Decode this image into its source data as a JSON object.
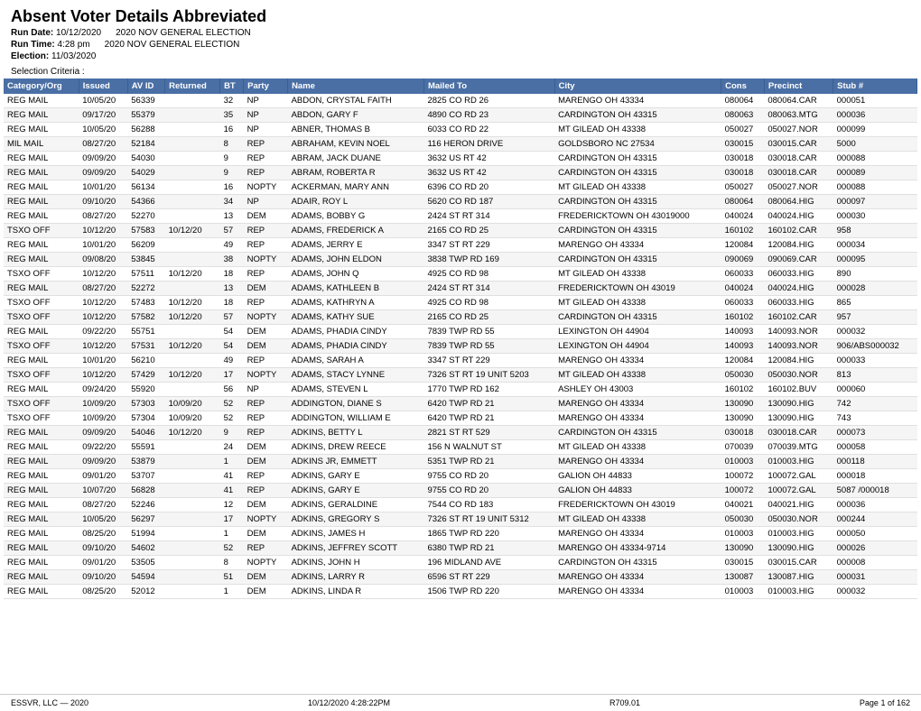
{
  "header": {
    "title": "Absent Voter Details Abbreviated",
    "run_date_label": "Run Date:",
    "run_date_value": "10/12/2020",
    "run_date_election": "2020 NOV GENERAL ELECTION",
    "run_time_label": "Run Time:",
    "run_time_value": "4:28 pm",
    "run_time_election": "2020 NOV GENERAL ELECTION",
    "election_label": "Election:",
    "election_value": "11/03/2020",
    "selection_label": "Selection Criteria :"
  },
  "columns": [
    "Category/Org",
    "Issued",
    "AV ID",
    "Returned",
    "BT",
    "Party",
    "Name",
    "Mailed To",
    "City",
    "Cons",
    "Precinct",
    "Stub #"
  ],
  "rows": [
    [
      "REG",
      "MAIL",
      "10/05/20",
      "56339",
      "",
      "32",
      "NP",
      "ABDON, CRYSTAL FAITH",
      "2825 CO RD 26",
      "MARENGO OH 43334",
      "080064",
      "080064.CAR",
      "000051"
    ],
    [
      "REG",
      "MAIL",
      "09/17/20",
      "55379",
      "",
      "35",
      "NP",
      "ABDON, GARY F",
      "4890 CO RD 23",
      "CARDINGTON OH 43315",
      "080063",
      "080063.MTG",
      "000036"
    ],
    [
      "REG",
      "MAIL",
      "10/05/20",
      "56288",
      "",
      "16",
      "NP",
      "ABNER, THOMAS B",
      "6033 CO RD 22",
      "MT GILEAD OH 43338",
      "050027",
      "050027.NOR",
      "000099"
    ],
    [
      "MIL",
      "MAIL",
      "08/27/20",
      "52184",
      "",
      "8",
      "REP",
      "ABRAHAM, KEVIN NOEL",
      "116 HERON DRIVE",
      "GOLDSBORO NC 27534",
      "030015",
      "030015.CAR",
      "5000"
    ],
    [
      "REG",
      "MAIL",
      "09/09/20",
      "54030",
      "",
      "9",
      "REP",
      "ABRAM, JACK DUANE",
      "3632 US RT 42",
      "CARDINGTON OH 43315",
      "030018",
      "030018.CAR",
      "000088"
    ],
    [
      "REG",
      "MAIL",
      "09/09/20",
      "54029",
      "",
      "9",
      "REP",
      "ABRAM, ROBERTA R",
      "3632 US RT 42",
      "CARDINGTON OH 43315",
      "030018",
      "030018.CAR",
      "000089"
    ],
    [
      "REG",
      "MAIL",
      "10/01/20",
      "56134",
      "",
      "16",
      "NOPTY",
      "ACKERMAN, MARY ANN",
      "6396 CO RD 20",
      "MT GILEAD OH 43338",
      "050027",
      "050027.NOR",
      "000088"
    ],
    [
      "REG",
      "MAIL",
      "09/10/20",
      "54366",
      "",
      "34",
      "NP",
      "ADAIR, ROY L",
      "5620 CO RD 187",
      "CARDINGTON OH 43315",
      "080064",
      "080064.HIG",
      "000097"
    ],
    [
      "REG",
      "MAIL",
      "08/27/20",
      "52270",
      "",
      "13",
      "DEM",
      "ADAMS, BOBBY G",
      "2424 ST RT 314",
      "FREDERICKTOWN OH 43019000",
      "040024",
      "040024.HIG",
      "000030"
    ],
    [
      "TSXO",
      "OFF",
      "10/12/20",
      "57583",
      "10/12/20",
      "57",
      "REP",
      "ADAMS, FREDERICK A",
      "2165 CO RD 25",
      "CARDINGTON OH 43315",
      "160102",
      "160102.CAR",
      "958"
    ],
    [
      "REG",
      "MAIL",
      "10/01/20",
      "56209",
      "",
      "49",
      "REP",
      "ADAMS, JERRY E",
      "3347 ST RT 229",
      "MARENGO OH 43334",
      "120084",
      "120084.HIG",
      "000034"
    ],
    [
      "REG",
      "MAIL",
      "09/08/20",
      "53845",
      "",
      "38",
      "NOPTY",
      "ADAMS, JOHN ELDON",
      "3838 TWP RD 169",
      "CARDINGTON OH 43315",
      "090069",
      "090069.CAR",
      "000095"
    ],
    [
      "TSXO",
      "OFF",
      "10/12/20",
      "57511",
      "10/12/20",
      "18",
      "REP",
      "ADAMS, JOHN Q",
      "4925 CO RD 98",
      "MT GILEAD OH 43338",
      "060033",
      "060033.HIG",
      "890"
    ],
    [
      "REG",
      "MAIL",
      "08/27/20",
      "52272",
      "",
      "13",
      "DEM",
      "ADAMS, KATHLEEN B",
      "2424 ST RT 314",
      "FREDERICKTOWN OH 43019",
      "040024",
      "040024.HIG",
      "000028"
    ],
    [
      "TSXO",
      "OFF",
      "10/12/20",
      "57483",
      "10/12/20",
      "18",
      "REP",
      "ADAMS, KATHRYN A",
      "4925 CO RD 98",
      "MT GILEAD OH 43338",
      "060033",
      "060033.HIG",
      "865"
    ],
    [
      "TSXO",
      "OFF",
      "10/12/20",
      "57582",
      "10/12/20",
      "57",
      "NOPTY",
      "ADAMS, KATHY SUE",
      "2165 CO RD 25",
      "CARDINGTON OH 43315",
      "160102",
      "160102.CAR",
      "957"
    ],
    [
      "REG",
      "MAIL",
      "09/22/20",
      "55751",
      "",
      "54",
      "DEM",
      "ADAMS, PHADIA CINDY",
      "7839 TWP RD 55",
      "LEXINGTON OH 44904",
      "140093",
      "140093.NOR",
      "000032"
    ],
    [
      "TSXO",
      "OFF",
      "10/12/20",
      "57531",
      "10/12/20",
      "54",
      "DEM",
      "ADAMS, PHADIA CINDY",
      "7839 TWP RD 55",
      "LEXINGTON OH 44904",
      "140093",
      "140093.NOR",
      "906/ABS000032"
    ],
    [
      "REG",
      "MAIL",
      "10/01/20",
      "56210",
      "",
      "49",
      "REP",
      "ADAMS, SARAH A",
      "3347 ST RT 229",
      "MARENGO OH 43334",
      "120084",
      "120084.HIG",
      "000033"
    ],
    [
      "TSXO",
      "OFF",
      "10/12/20",
      "57429",
      "10/12/20",
      "17",
      "NOPTY",
      "ADAMS, STACY LYNNE",
      "7326 ST RT 19 UNIT 5203",
      "MT GILEAD OH 43338",
      "050030",
      "050030.NOR",
      "813"
    ],
    [
      "REG",
      "MAIL",
      "09/24/20",
      "55920",
      "",
      "56",
      "NP",
      "ADAMS, STEVEN L",
      "1770 TWP RD 162",
      "ASHLEY OH 43003",
      "160102",
      "160102.BUV",
      "000060"
    ],
    [
      "TSXO",
      "OFF",
      "10/09/20",
      "57303",
      "10/09/20",
      "52",
      "REP",
      "ADDINGTON, DIANE S",
      "6420 TWP RD 21",
      "MARENGO OH 43334",
      "130090",
      "130090.HIG",
      "742"
    ],
    [
      "TSXO",
      "OFF",
      "10/09/20",
      "57304",
      "10/09/20",
      "52",
      "REP",
      "ADDINGTON, WILLIAM E",
      "6420 TWP RD 21",
      "MARENGO OH 43334",
      "130090",
      "130090.HIG",
      "743"
    ],
    [
      "REG",
      "MAIL",
      "09/09/20",
      "54046",
      "10/12/20",
      "9",
      "REP",
      "ADKINS, BETTY L",
      "2821 ST RT 529",
      "CARDINGTON OH 43315",
      "030018",
      "030018.CAR",
      "000073"
    ],
    [
      "REG",
      "MAIL",
      "09/22/20",
      "55591",
      "",
      "24",
      "DEM",
      "ADKINS, DREW REECE",
      "156 N WALNUT ST",
      "MT GILEAD OH 43338",
      "070039",
      "070039.MTG",
      "000058"
    ],
    [
      "REG",
      "MAIL",
      "09/09/20",
      "53879",
      "",
      "1",
      "DEM",
      "ADKINS JR, EMMETT",
      "5351 TWP RD 21",
      "MARENGO OH 43334",
      "010003",
      "010003.HIG",
      "000118"
    ],
    [
      "REG",
      "MAIL",
      "09/01/20",
      "53707",
      "",
      "41",
      "REP",
      "ADKINS, GARY E",
      "9755 CO RD 20",
      "GALION OH 44833",
      "100072",
      "100072.GAL",
      "000018"
    ],
    [
      "REG",
      "MAIL",
      "10/07/20",
      "56828",
      "",
      "41",
      "REP",
      "ADKINS, GARY E",
      "9755 CO RD 20",
      "GALION OH 44833",
      "100072",
      "100072.GAL",
      "5087 /000018"
    ],
    [
      "REG",
      "MAIL",
      "08/27/20",
      "52246",
      "",
      "12",
      "DEM",
      "ADKINS, GERALDINE",
      "7544 CO RD 183",
      "FREDERICKTOWN OH 43019",
      "040021",
      "040021.HIG",
      "000036"
    ],
    [
      "REG",
      "MAIL",
      "10/05/20",
      "56297",
      "",
      "17",
      "NOPTY",
      "ADKINS, GREGORY S",
      "7326 ST RT 19 UNIT 5312",
      "MT GILEAD OH 43338",
      "050030",
      "050030.NOR",
      "000244"
    ],
    [
      "REG",
      "MAIL",
      "08/25/20",
      "51994",
      "",
      "1",
      "DEM",
      "ADKINS, JAMES H",
      "1865 TWP RD 220",
      "MARENGO OH 43334",
      "010003",
      "010003.HIG",
      "000050"
    ],
    [
      "REG",
      "MAIL",
      "09/10/20",
      "54602",
      "",
      "52",
      "REP",
      "ADKINS, JEFFREY SCOTT",
      "6380 TWP RD 21",
      "MARENGO OH 43334-9714",
      "130090",
      "130090.HIG",
      "000026"
    ],
    [
      "REG",
      "MAIL",
      "09/01/20",
      "53505",
      "",
      "8",
      "NOPTY",
      "ADKINS, JOHN H",
      "196 MIDLAND AVE",
      "CARDINGTON OH 43315",
      "030015",
      "030015.CAR",
      "000008"
    ],
    [
      "REG",
      "MAIL",
      "09/10/20",
      "54594",
      "",
      "51",
      "DEM",
      "ADKINS, LARRY R",
      "6596 ST RT 229",
      "MARENGO OH 43334",
      "130087",
      "130087.HIG",
      "000031"
    ],
    [
      "REG",
      "MAIL",
      "08/25/20",
      "52012",
      "",
      "1",
      "DEM",
      "ADKINS, LINDA R",
      "1506 TWP RD 220",
      "MARENGO OH 43334",
      "010003",
      "010003.HIG",
      "000032"
    ]
  ],
  "footer": {
    "company": "ESSVR, LLC — 2020",
    "datetime": "10/12/2020   4:28:22PM",
    "report": "R709.01",
    "page": "Page 1 of 162"
  }
}
